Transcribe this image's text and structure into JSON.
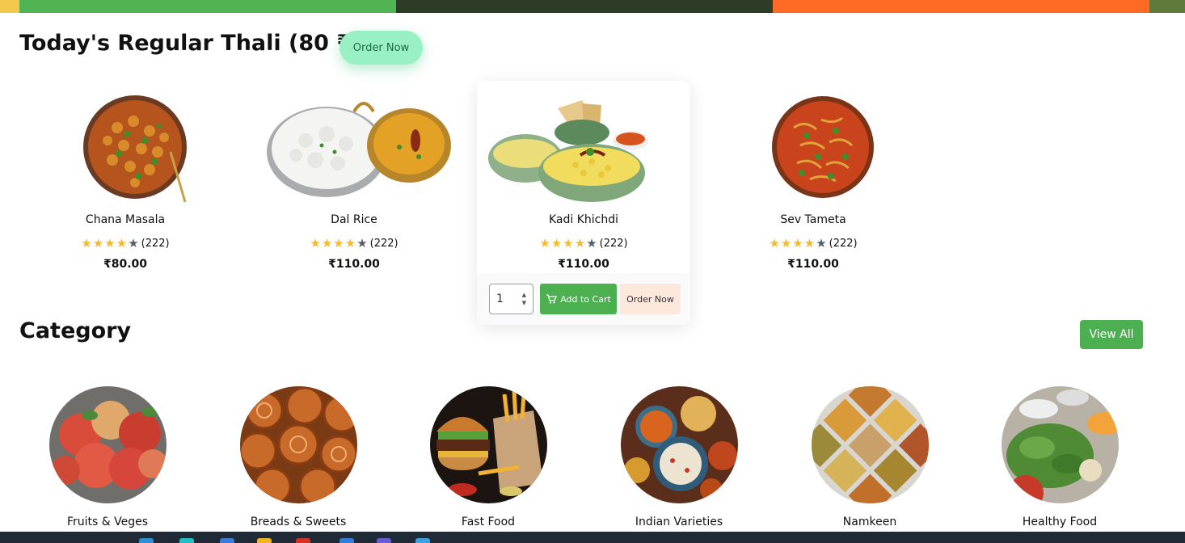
{
  "colors": {
    "strip": [
      "#f2c94c",
      "#52b355",
      "#2c3c27",
      "#ff6b24",
      "#5f7a3a"
    ],
    "accent_green": "#4caf50",
    "order_pill": "#9af0c5",
    "order_card": "#fde8de",
    "star": "#f7b928",
    "star_empty": "#555d66"
  },
  "thali": {
    "title": "Today's Regular Thali (80 ₹):",
    "order_now": "Order Now"
  },
  "products": [
    {
      "name": "Chana Masala",
      "rating_count": "(222)",
      "stars_filled": 4,
      "stars_total": 5,
      "price": "₹80.00",
      "image_icon": "chana-masala-bowl"
    },
    {
      "name": "Dal Rice",
      "rating_count": "(222)",
      "stars_filled": 4,
      "stars_total": 5,
      "price": "₹110.00",
      "image_icon": "dal-rice-plate"
    },
    {
      "name": "Kadi Khichdi",
      "rating_count": "(222)",
      "stars_filled": 4,
      "stars_total": 5,
      "price": "₹110.00",
      "image_icon": "kadi-khichdi-bowls"
    },
    {
      "name": "Sev Tameta",
      "rating_count": "(222)",
      "stars_filled": 4,
      "stars_total": 5,
      "price": "₹110.00",
      "image_icon": "sev-tameta-bowl"
    }
  ],
  "featured_card": {
    "quantity": "1",
    "add_to_cart": "Add to Cart",
    "order_now": "Order Now"
  },
  "category": {
    "title": "Category",
    "view_all": "View All",
    "items": [
      {
        "label": "Fruits & Veges",
        "image_icon": "apples-photo"
      },
      {
        "label": "Breads & Sweets",
        "image_icon": "pastries-photo"
      },
      {
        "label": "Fast Food",
        "image_icon": "burger-fries-photo"
      },
      {
        "label": "Indian Varieties",
        "image_icon": "indian-dishes-photo"
      },
      {
        "label": "Namkeen",
        "image_icon": "namkeen-trays-photo"
      },
      {
        "label": "Healthy Food",
        "image_icon": "salad-spread-photo"
      }
    ]
  }
}
